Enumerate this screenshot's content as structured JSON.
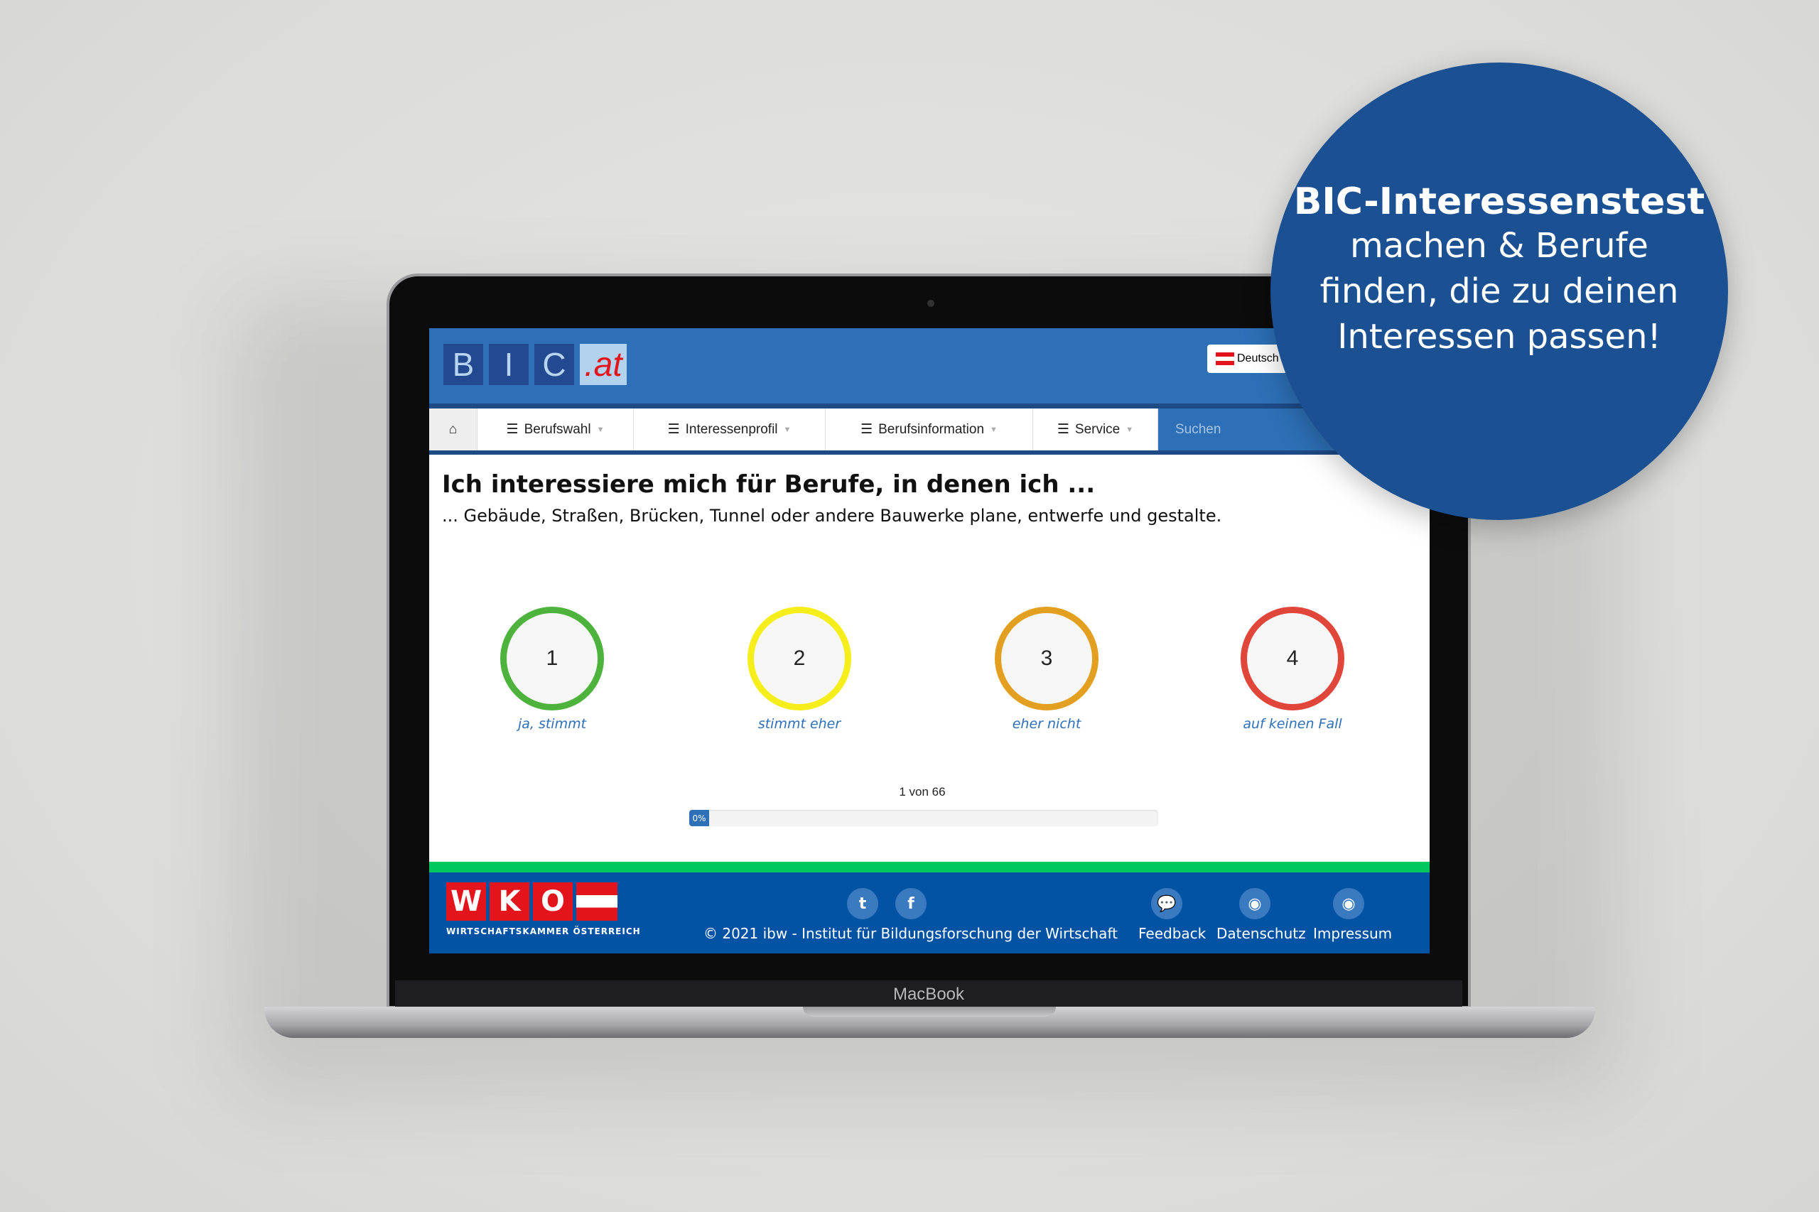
{
  "laptop": {
    "brand": "MacBook"
  },
  "header": {
    "logo_letters": [
      "B",
      "I",
      "C"
    ],
    "logo_suffix": ".at",
    "language": "Deutsch"
  },
  "nav": {
    "home_icon": "home-icon",
    "items": [
      {
        "label": "Berufswahl"
      },
      {
        "label": "Interessenprofil"
      },
      {
        "label": "Berufsinformation"
      },
      {
        "label": "Service"
      }
    ],
    "search_placeholder": "Suchen"
  },
  "question": {
    "title": "Ich interessiere mich für Berufe, in denen ich ...",
    "text": "... Gebäude, Straßen, Brücken, Tunnel oder andere Bauwerke plane, entwerfe und gestalte."
  },
  "options": [
    {
      "number": "1",
      "label": "ja, stimmt",
      "color": "#4db33d"
    },
    {
      "number": "2",
      "label": "stimmt eher",
      "color": "#f5ee1a"
    },
    {
      "number": "3",
      "label": "eher nicht",
      "color": "#e3a020"
    },
    {
      "number": "4",
      "label": "auf keinen Fall",
      "color": "#e0473a"
    }
  ],
  "progress": {
    "counter": "1 von 66",
    "percent_label": "0%",
    "percent": 0
  },
  "footer": {
    "wko_letters": [
      "W",
      "K",
      "O"
    ],
    "wko_text": "WIRTSCHAFTSKAMMER ÖSTERREICH",
    "copyright": "© 2021 ibw - Institut für Bildungsforschung der Wirtschaft",
    "links": [
      "Feedback",
      "Datenschutz",
      "Impressum"
    ]
  },
  "badge": {
    "title": "BIC-Interessenstest",
    "lines": [
      "machen & Berufe",
      "finden, die zu deinen",
      "Interessen passen!"
    ],
    "color": "#1b5193"
  }
}
